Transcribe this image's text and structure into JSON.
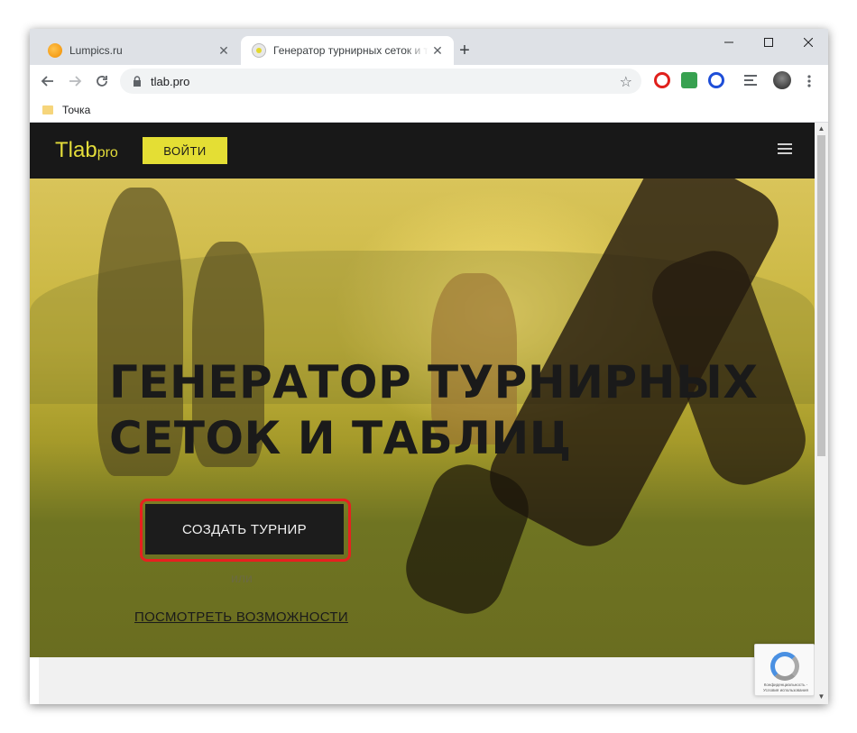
{
  "browser": {
    "tabs": [
      {
        "title": "Lumpics.ru",
        "active": false,
        "close": "✕"
      },
      {
        "title": "Генератор турнирных сеток и таблиц",
        "active": true,
        "close": "✕"
      }
    ],
    "new_tab": "+",
    "url": "tlab.pro",
    "bookmarks": [
      {
        "label": "Точка"
      }
    ],
    "colors": {
      "tabstrip": "#dee1e6",
      "omnibox": "#f1f3f4"
    }
  },
  "site": {
    "logo_main": "Tlab",
    "logo_suffix": "pro",
    "login_label": "ВОЙТИ",
    "hero_title_line1": "ГЕНЕРАТОР ТУРНИРНЫХ",
    "hero_title_line2": "СЕТОК И ТАБЛИЦ",
    "create_label": "СОЗДАТЬ ТУРНИР",
    "or_text": "или",
    "features_link": "ПОСМОТРЕТЬ ВОЗМОЖНОСТИ",
    "recaptcha_text": "Конфиденциальность - Условия использования",
    "colors": {
      "accent": "#e4de34",
      "header": "#181818",
      "highlight": "#e8201f"
    }
  }
}
